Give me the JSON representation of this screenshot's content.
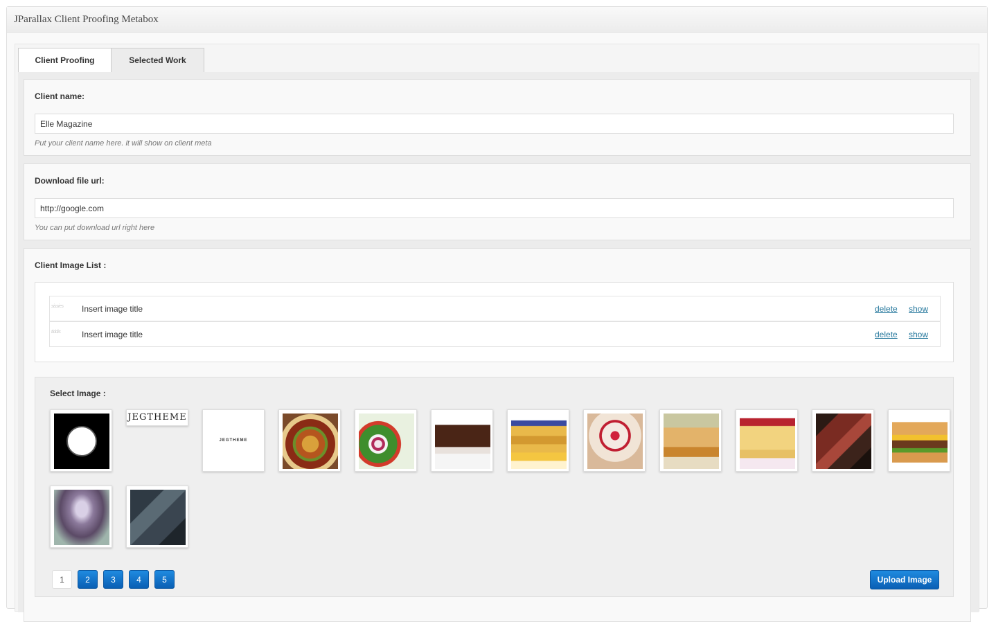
{
  "metabox": {
    "title": "JParallax Client Proofing Metabox"
  },
  "tabs": [
    {
      "label": "Client Proofing"
    },
    {
      "label": "Selected Work"
    }
  ],
  "client_name": {
    "label": "Client name:",
    "value": "Elle Magazine",
    "hint": "Put your client name here. it will show on client meta"
  },
  "download_url": {
    "label": "Download file url:",
    "value": "http://google.com",
    "hint": "You can put download url right here"
  },
  "image_list": {
    "label": "Client Image List :",
    "rows": [
      {
        "thumb_text": "sissies",
        "title": "Insert image title",
        "delete": "delete",
        "show": "show"
      },
      {
        "thumb_text": "tiddis",
        "title": "Insert image title",
        "delete": "delete",
        "show": "show"
      }
    ]
  },
  "select_image": {
    "label": "Select Image :",
    "thumbs": [
      {
        "icon": "black-circle-image"
      },
      {
        "icon": "jegtheme-script-logo",
        "text": "JEGTHEME"
      },
      {
        "icon": "jegtheme-small-logo",
        "text": "JEGTHEME"
      },
      {
        "icon": "pizza-image"
      },
      {
        "icon": "salad-image"
      },
      {
        "icon": "chocolate-cake-image"
      },
      {
        "icon": "pancakes-image"
      },
      {
        "icon": "raspberry-cake-image"
      },
      {
        "icon": "pasta-image"
      },
      {
        "icon": "crepes-image"
      },
      {
        "icon": "steak-image"
      },
      {
        "icon": "burger-image"
      },
      {
        "icon": "purple-blur-image"
      },
      {
        "icon": "office-man-image"
      }
    ],
    "pages": [
      "1",
      "2",
      "3",
      "4",
      "5"
    ],
    "current_page": "1",
    "upload_label": "Upload Image"
  },
  "colors": {
    "link": "#21759b",
    "button_blue": "#0a74da"
  }
}
